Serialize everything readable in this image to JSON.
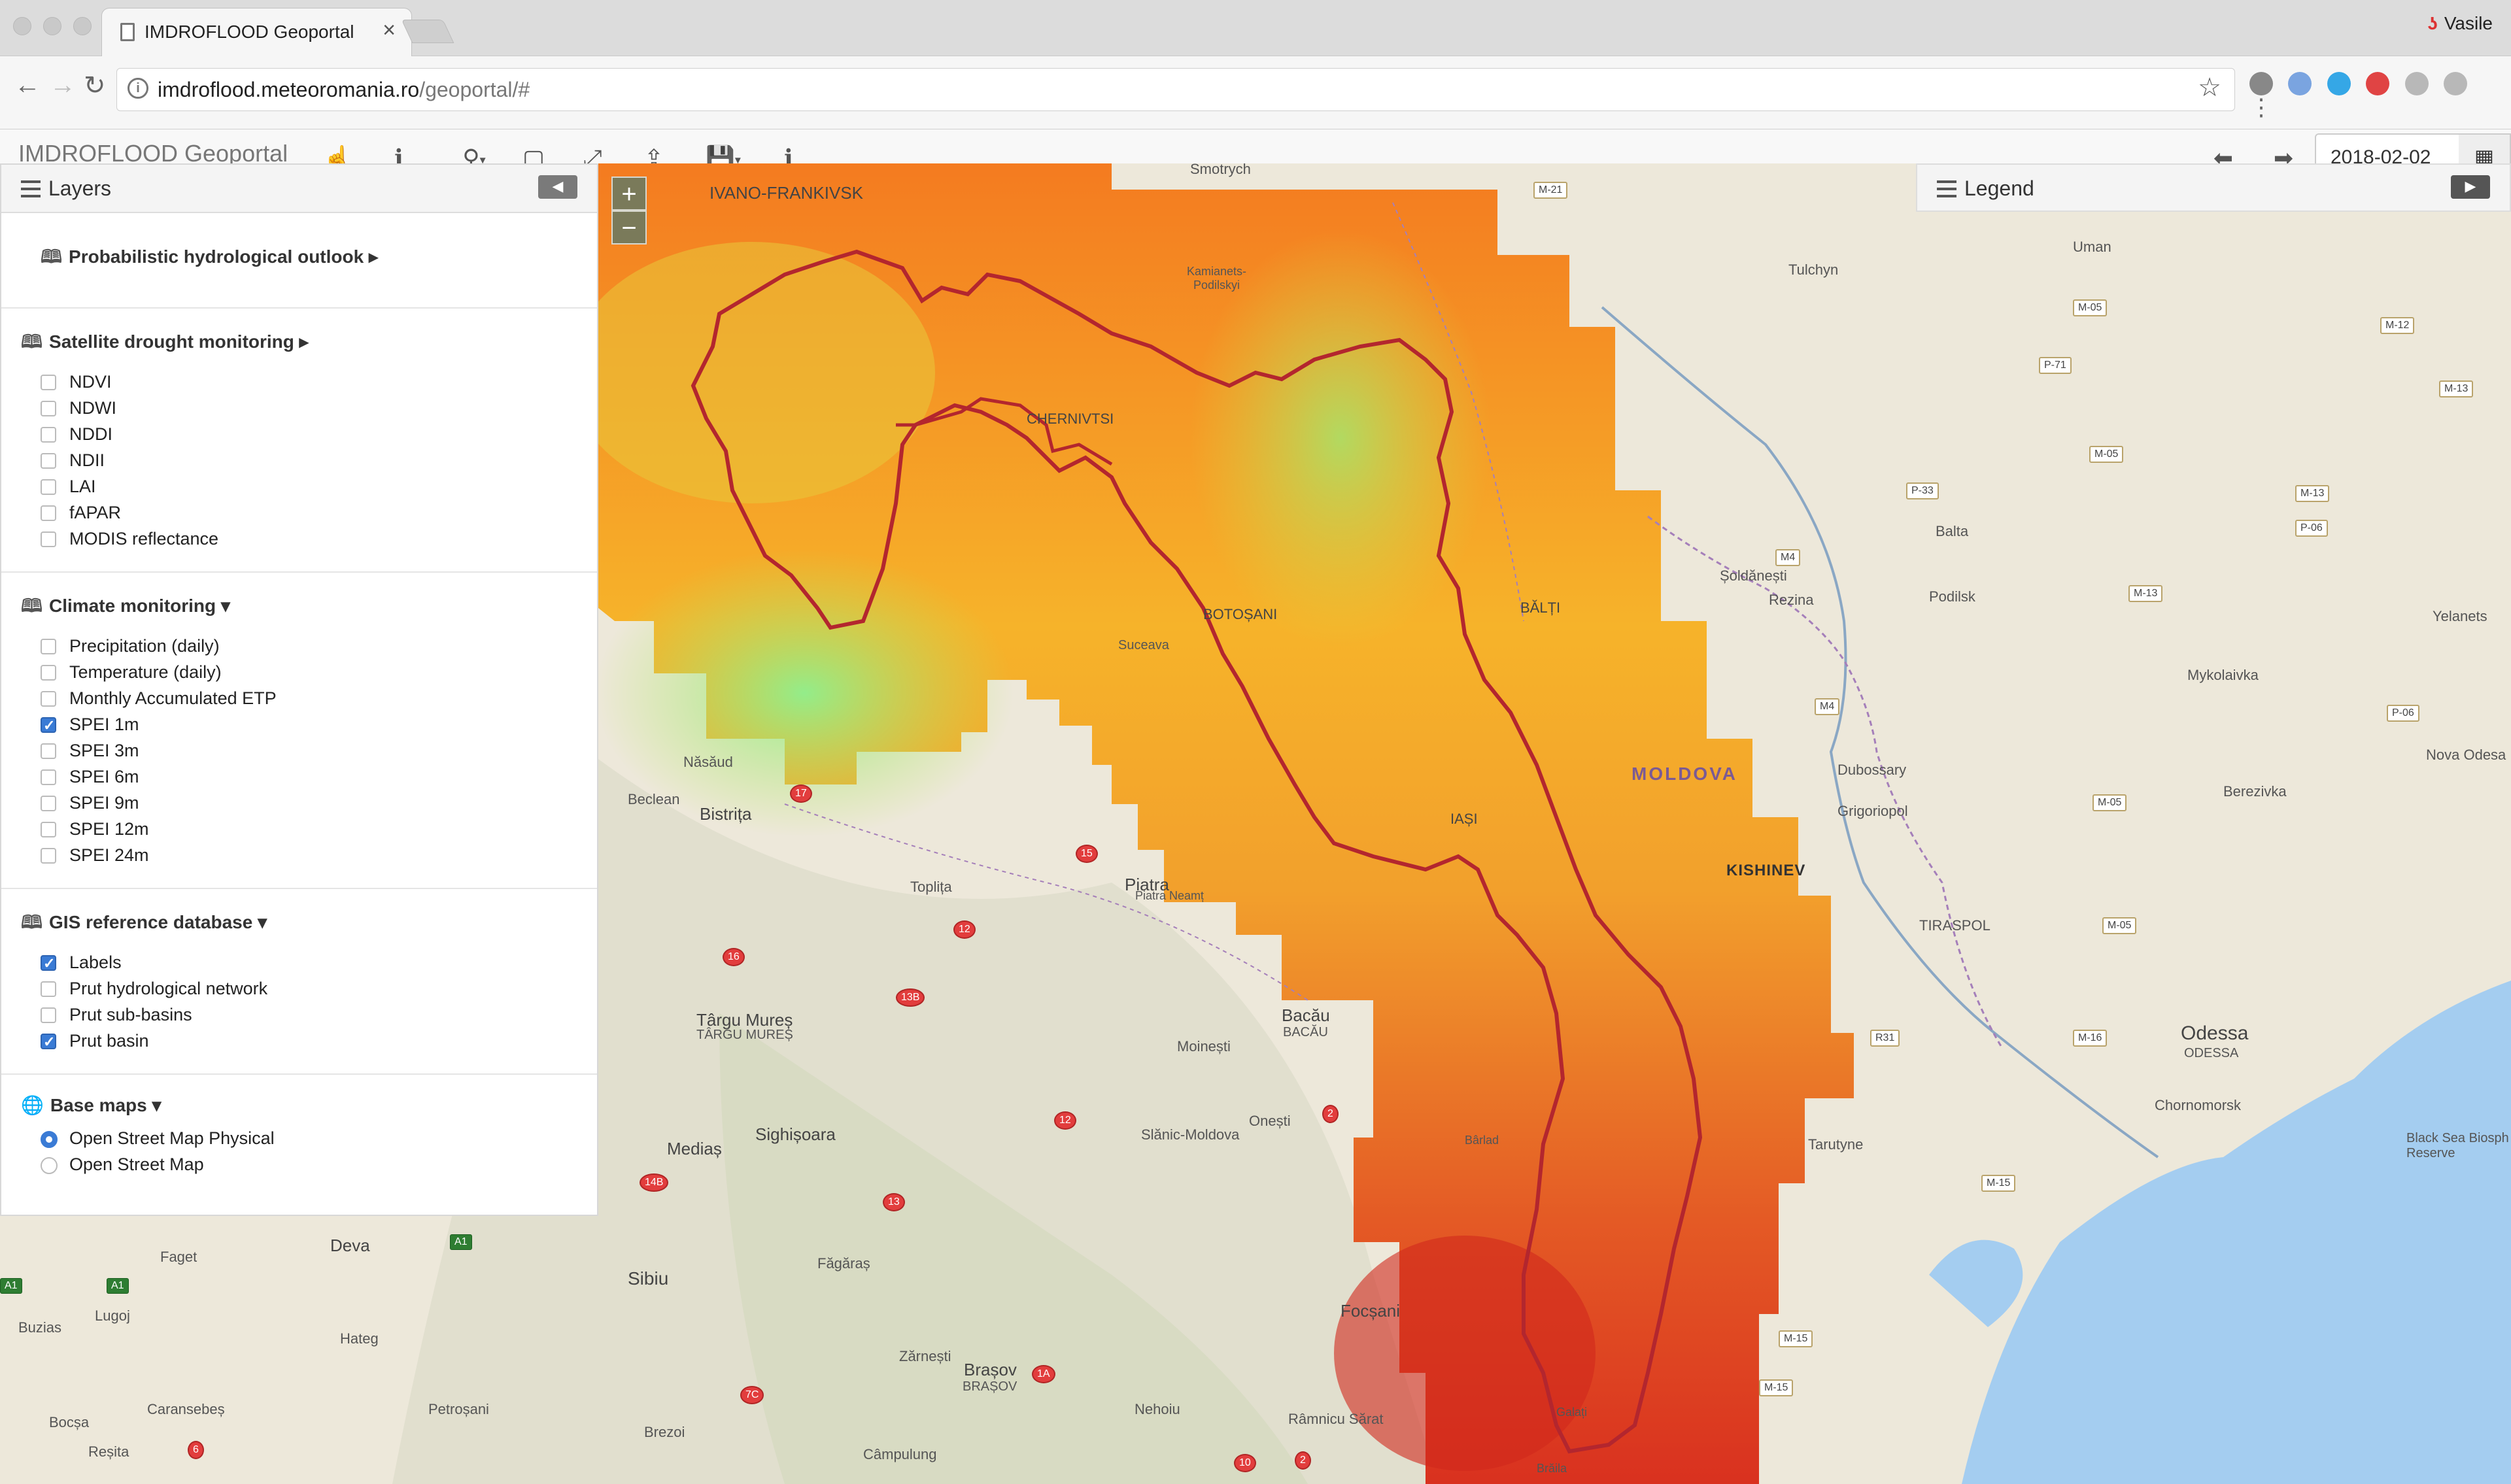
{
  "browser": {
    "tab_title": "IMDROFLOOD Geoportal",
    "tab_close": "×",
    "user_name": "Vasile",
    "url_host": "imdroflood.meteoromania.ro",
    "url_path": "/geoportal/#"
  },
  "toolbar": {
    "brand": "IMDROFLOOD Geoportal",
    "tools": [
      {
        "icon": "hand-pointer-icon",
        "glyph": "☝"
      },
      {
        "icon": "info-icon",
        "glyph": "ℹ"
      },
      {
        "icon": "search-dropdown-icon",
        "glyph": "⚲"
      },
      {
        "icon": "select-box-icon",
        "glyph": "▢"
      },
      {
        "icon": "fullscreen-icon",
        "glyph": "⤢"
      },
      {
        "icon": "upload-icon",
        "glyph": "⇪"
      },
      {
        "icon": "save-dropdown-icon",
        "glyph": "💾"
      },
      {
        "icon": "about-info-icon",
        "glyph": "ℹ"
      }
    ],
    "prev_glyph": "⬅",
    "next_glyph": "➡",
    "date_value": "2018-02-02",
    "calendar_glyph": "▦"
  },
  "layers_panel": {
    "title": "Layers",
    "collapse_glyph": "◀",
    "groups": [
      {
        "title": "Probabilistic hydrological outlook",
        "caret": "▸",
        "items": []
      },
      {
        "title": "Satellite drought monitoring",
        "caret": "▸",
        "items": [
          {
            "label": "NDVI",
            "checked": false
          },
          {
            "label": "NDWI",
            "checked": false
          },
          {
            "label": "NDDI",
            "checked": false
          },
          {
            "label": "NDII",
            "checked": false
          },
          {
            "label": "LAI",
            "checked": false
          },
          {
            "label": "fAPAR",
            "checked": false
          },
          {
            "label": "MODIS reflectance",
            "checked": false
          }
        ]
      },
      {
        "title": "Climate monitoring",
        "caret": "▾",
        "items": [
          {
            "label": "Precipitation (daily)",
            "checked": false
          },
          {
            "label": "Temperature (daily)",
            "checked": false
          },
          {
            "label": "Monthly Accumulated ETP",
            "checked": false
          },
          {
            "label": "SPEI 1m",
            "checked": true
          },
          {
            "label": "SPEI 3m",
            "checked": false
          },
          {
            "label": "SPEI 6m",
            "checked": false
          },
          {
            "label": "SPEI 9m",
            "checked": false
          },
          {
            "label": "SPEI 12m",
            "checked": false
          },
          {
            "label": "SPEI 24m",
            "checked": false
          }
        ]
      },
      {
        "title": "GIS reference database",
        "caret": "▾",
        "items": [
          {
            "label": "Labels",
            "checked": true
          },
          {
            "label": "Prut hydrological network",
            "checked": false
          },
          {
            "label": "Prut sub-basins",
            "checked": false
          },
          {
            "label": "Prut basin",
            "checked": true
          }
        ]
      }
    ],
    "base_maps": {
      "title": "Base maps",
      "caret": "▾",
      "options": [
        {
          "label": "Open Street Map Physical",
          "selected": true
        },
        {
          "label": "Open Street Map",
          "selected": false
        }
      ]
    }
  },
  "legend_panel": {
    "title": "Legend",
    "expand_glyph": "▶"
  },
  "map": {
    "zoom_in": "+",
    "zoom_out": "−",
    "labels": {
      "ivano": "IVANO-FRANKIVSK",
      "smotrych": "Smotrych",
      "kamianets": "Kamianets-\nPodilskyi",
      "chernivtsi": "CHERNIVTSI",
      "botosani": "BOTOȘANI",
      "suceava": "Suceava",
      "balti": "BĂLȚI",
      "iasi": "IAȘI",
      "moldova": "MOLDOVA",
      "kishinev": "KISHINEV",
      "tiraspol": "TIRASPOL",
      "odessa": "Odessa",
      "odessa2": "ODESSA",
      "bistrita": "Bistrița",
      "beclean": "Beclean",
      "nasaud": "Năsăud",
      "toplita": "Toplița",
      "piatra": "Piatra",
      "piatra_neamt": "Piatra Neamț",
      "bacau": "Bacău",
      "bacau2": "BACĂU",
      "targu_mures": "Târgu Mureș",
      "targu_mures2": "TÂRGU MUREȘ",
      "sighisoara": "Sighișoara",
      "medias": "Mediaș",
      "brasov": "Brașov",
      "brasov2": "BRAȘOV",
      "barlad": "Bârlad",
      "galati": "Galați",
      "braila": "Brăila",
      "focsani": "Focșani",
      "sibiu": "Sibiu",
      "fagaras": "Făgăraș",
      "campulung": "Câmpulung",
      "deva": "Deva",
      "lugoj": "Lugoj",
      "hateg": "Hateg",
      "buzias": "Buzias",
      "fagetu": "Faget",
      "resita": "Reșita",
      "bocsa": "Bocșa",
      "caransebes": "Caransebeș",
      "petrosani": "Petroșani",
      "brezoi": "Brezoi",
      "nehoiu": "Nehoiu",
      "zarnesti": "Zărnești",
      "rm_sarat": "Râmnicu Sărat",
      "slanic": "Slănic-Moldova",
      "onesti": "Onești",
      "moinesti": "Moinești",
      "tarutyne": "Tarutyne",
      "chornomorsk": "Chornomorsk",
      "tulchyn": "Tulchyn",
      "uman": "Uman",
      "balta": "Balta",
      "podilsk": "Podilsk",
      "rezina": "Rezina",
      "soldanesti": "Șoldănești",
      "dubossary": "Dubossary",
      "grigoriopol": "Grigoriopol",
      "yelanets": "Yelanets",
      "berezivka": "Berezivka",
      "mykolaivka": "Mykolaivka",
      "nova_odesa": "Nova Odesa",
      "black_sea": "Black Sea Biosph\nReserve"
    }
  }
}
